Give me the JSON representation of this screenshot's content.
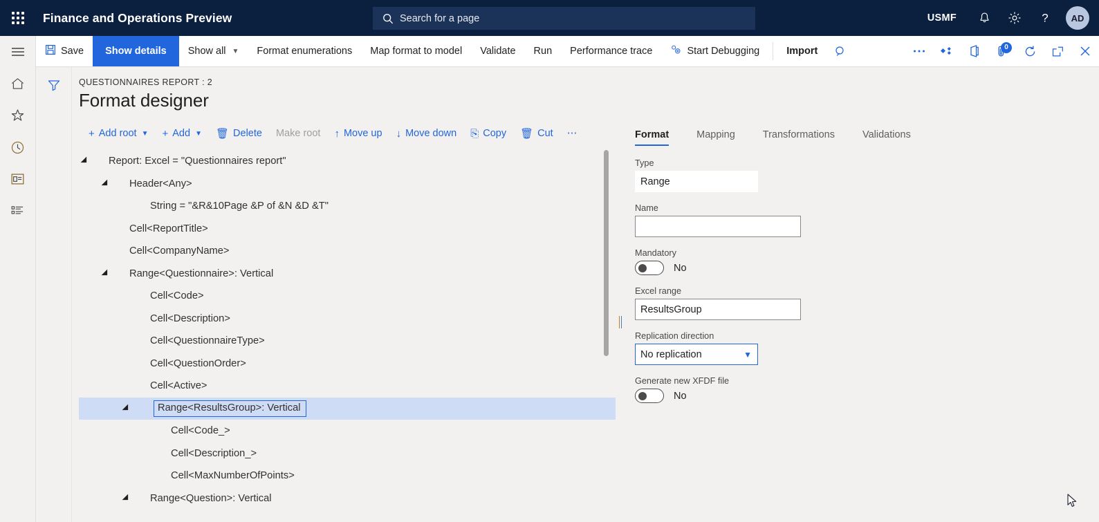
{
  "topbar": {
    "waffle_name": "app-launcher",
    "app_title": "Finance and Operations Preview",
    "search_placeholder": "Search for a page",
    "company": "USMF",
    "avatar_initials": "AD",
    "icons": [
      "notifications-icon",
      "settings-gear-icon",
      "help-icon"
    ],
    "bg_color": "#0b1f3f",
    "search_bg_color": "#1c3359"
  },
  "railnav": {
    "items": [
      {
        "name": "hamburger-menu-icon"
      },
      {
        "name": "home-icon"
      },
      {
        "name": "favorites-star-icon"
      },
      {
        "name": "recent-clock-icon"
      },
      {
        "name": "workspaces-icon"
      },
      {
        "name": "modules-list-icon"
      }
    ]
  },
  "commandbar": {
    "save_label": "Save",
    "show_details_label": "Show details",
    "show_all_label": "Show all",
    "format_enumerations_label": "Format enumerations",
    "map_format_to_model_label": "Map format to model",
    "validate_label": "Validate",
    "run_label": "Run",
    "performance_trace_label": "Performance trace",
    "start_debugging_label": "Start Debugging",
    "import_label": "Import",
    "primary_color": "#2266dd",
    "attachment_badge_count": "0",
    "right_icons": [
      "overflow-ellipsis-icon",
      "personalize-icon",
      "office-app-icon",
      "attachments-icon",
      "refresh-icon",
      "open-in-new-window-icon",
      "close-icon"
    ]
  },
  "page": {
    "breadcrumb": "QUESTIONNAIRES REPORT : 2",
    "title": "Format designer",
    "filter_icon": "filter-funnel-icon"
  },
  "actionbar": {
    "items": [
      {
        "glyph": "+",
        "label": "Add root",
        "caret": "⌄",
        "disabled": false,
        "name": "add-root-button"
      },
      {
        "glyph": "+",
        "label": "Add",
        "caret": "⌄",
        "disabled": false,
        "name": "add-button"
      },
      {
        "glyph": "🗑",
        "label": "Delete",
        "caret": "",
        "disabled": false,
        "name": "delete-button"
      },
      {
        "glyph": "",
        "label": "Make root",
        "caret": "",
        "disabled": true,
        "name": "make-root-button"
      },
      {
        "glyph": "↑",
        "label": "Move up",
        "caret": "",
        "disabled": false,
        "name": "move-up-button"
      },
      {
        "glyph": "↓",
        "label": "Move down",
        "caret": "",
        "disabled": false,
        "name": "move-down-button"
      },
      {
        "glyph": "⎘",
        "label": "Copy",
        "caret": "",
        "disabled": false,
        "name": "copy-button"
      },
      {
        "glyph": "🗑",
        "label": "Cut",
        "caret": "",
        "disabled": false,
        "name": "cut-button"
      },
      {
        "glyph": "",
        "label": "⋯",
        "caret": "",
        "disabled": false,
        "name": "more-actions-button"
      }
    ]
  },
  "tree": {
    "rows": [
      {
        "label": "Report: Excel = \"Questionnaires report\"",
        "depth": 0,
        "expandable": true,
        "selected": false
      },
      {
        "label": "Header<Any>",
        "depth": 1,
        "expandable": true,
        "selected": false
      },
      {
        "label": "String = \"&R&10Page &P of &N &D &T\"",
        "depth": 2,
        "expandable": false,
        "selected": false
      },
      {
        "label": "Cell<ReportTitle>",
        "depth": 1,
        "expandable": false,
        "selected": false
      },
      {
        "label": "Cell<CompanyName>",
        "depth": 1,
        "expandable": false,
        "selected": false
      },
      {
        "label": "Range<Questionnaire>: Vertical",
        "depth": 1,
        "expandable": true,
        "selected": false
      },
      {
        "label": "Cell<Code>",
        "depth": 2,
        "expandable": false,
        "selected": false
      },
      {
        "label": "Cell<Description>",
        "depth": 2,
        "expandable": false,
        "selected": false
      },
      {
        "label": "Cell<QuestionnaireType>",
        "depth": 2,
        "expandable": false,
        "selected": false
      },
      {
        "label": "Cell<QuestionOrder>",
        "depth": 2,
        "expandable": false,
        "selected": false
      },
      {
        "label": "Cell<Active>",
        "depth": 2,
        "expandable": false,
        "selected": false
      },
      {
        "label": "Range<ResultsGroup>: Vertical",
        "depth": 2,
        "expandable": true,
        "selected": true
      },
      {
        "label": "Cell<Code_>",
        "depth": 3,
        "expandable": false,
        "selected": false
      },
      {
        "label": "Cell<Description_>",
        "depth": 3,
        "expandable": false,
        "selected": false
      },
      {
        "label": "Cell<MaxNumberOfPoints>",
        "depth": 3,
        "expandable": false,
        "selected": false
      },
      {
        "label": "Range<Question>: Vertical",
        "depth": 2,
        "expandable": true,
        "selected": false
      }
    ],
    "selection_bg": "#cfdcf5",
    "selection_border": "#2266dd"
  },
  "properties": {
    "tabs": [
      {
        "label": "Format",
        "active": true
      },
      {
        "label": "Mapping",
        "active": false
      },
      {
        "label": "Transformations",
        "active": false
      },
      {
        "label": "Validations",
        "active": false
      }
    ],
    "type_label": "Type",
    "type_value": "Range",
    "name_label": "Name",
    "name_value": "",
    "name_placeholder": "",
    "mandatory_label": "Mandatory",
    "mandatory_value": "No",
    "excel_range_label": "Excel range",
    "excel_range_value": "ResultsGroup",
    "replication_direction_label": "Replication direction",
    "replication_direction_value": "No replication",
    "generate_xfdf_label": "Generate new XFDF file",
    "generate_xfdf_value": "No"
  }
}
